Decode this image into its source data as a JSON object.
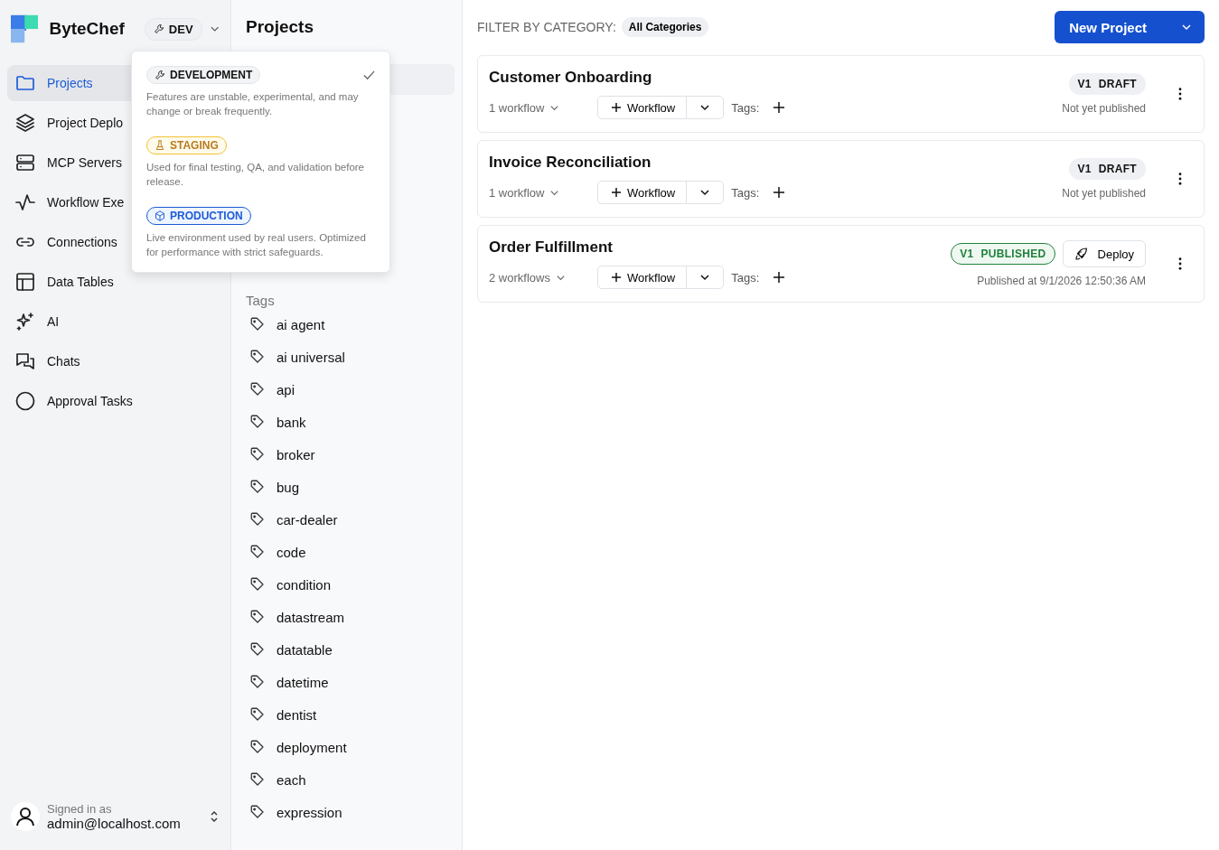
{
  "app": {
    "name": "ByteChef",
    "environment": "DEV"
  },
  "nav": [
    {
      "label": "Projects",
      "selected": true
    },
    {
      "label": "Project Deplo",
      "selected": false
    },
    {
      "label": "MCP Servers",
      "selected": false
    },
    {
      "label": "Workflow Exe",
      "selected": false
    },
    {
      "label": "Connections",
      "selected": false
    },
    {
      "label": "Data Tables",
      "selected": false
    },
    {
      "label": "AI",
      "selected": false
    },
    {
      "label": "Chats",
      "selected": false
    },
    {
      "label": "Approval Tasks",
      "selected": false
    }
  ],
  "user": {
    "caption": "Signed in as",
    "email": "admin@localhost.com"
  },
  "environment_menu": [
    {
      "kind": "development",
      "label": "DEVELOPMENT",
      "description": "Features are unstable, experimental, and may change or break frequently.",
      "selected": true
    },
    {
      "kind": "staging",
      "label": "STAGING",
      "description": "Used for final testing, QA, and validation before release.",
      "selected": false
    },
    {
      "kind": "production",
      "label": "PRODUCTION",
      "description": "Live environment used by real users. Optimized for performance with strict safeguards.",
      "selected": false
    }
  ],
  "projects_panel": {
    "title": "Projects",
    "tags_heading": "Tags",
    "tags": [
      "ai agent",
      "ai universal",
      "api",
      "bank",
      "broker",
      "bug",
      "car-dealer",
      "code",
      "condition",
      "datastream",
      "datatable",
      "datetime",
      "dentist",
      "deployment",
      "each",
      "expression"
    ]
  },
  "filter": {
    "label": "FILTER BY CATEGORY:",
    "value": "All Categories"
  },
  "new_project_button": "New Project",
  "projects": [
    {
      "name": "Customer Onboarding",
      "workflows": "1 workflow",
      "add_workflow": "Workflow",
      "tags_label": "Tags:",
      "version": "V1",
      "kind": "draft",
      "status_label": "DRAFT",
      "publish_info": "Not yet published"
    },
    {
      "name": "Invoice Reconciliation",
      "workflows": "1 workflow",
      "add_workflow": "Workflow",
      "tags_label": "Tags:",
      "version": "V1",
      "kind": "draft",
      "status_label": "DRAFT",
      "publish_info": "Not yet published"
    },
    {
      "name": "Order Fulfillment",
      "workflows": "2 workflows",
      "add_workflow": "Workflow",
      "tags_label": "Tags:",
      "version": "V1",
      "kind": "published",
      "status_label": "PUBLISHED",
      "deploy": "Deploy",
      "publish_info": "Published at 9/1/2026 12:50:36 AM"
    }
  ]
}
